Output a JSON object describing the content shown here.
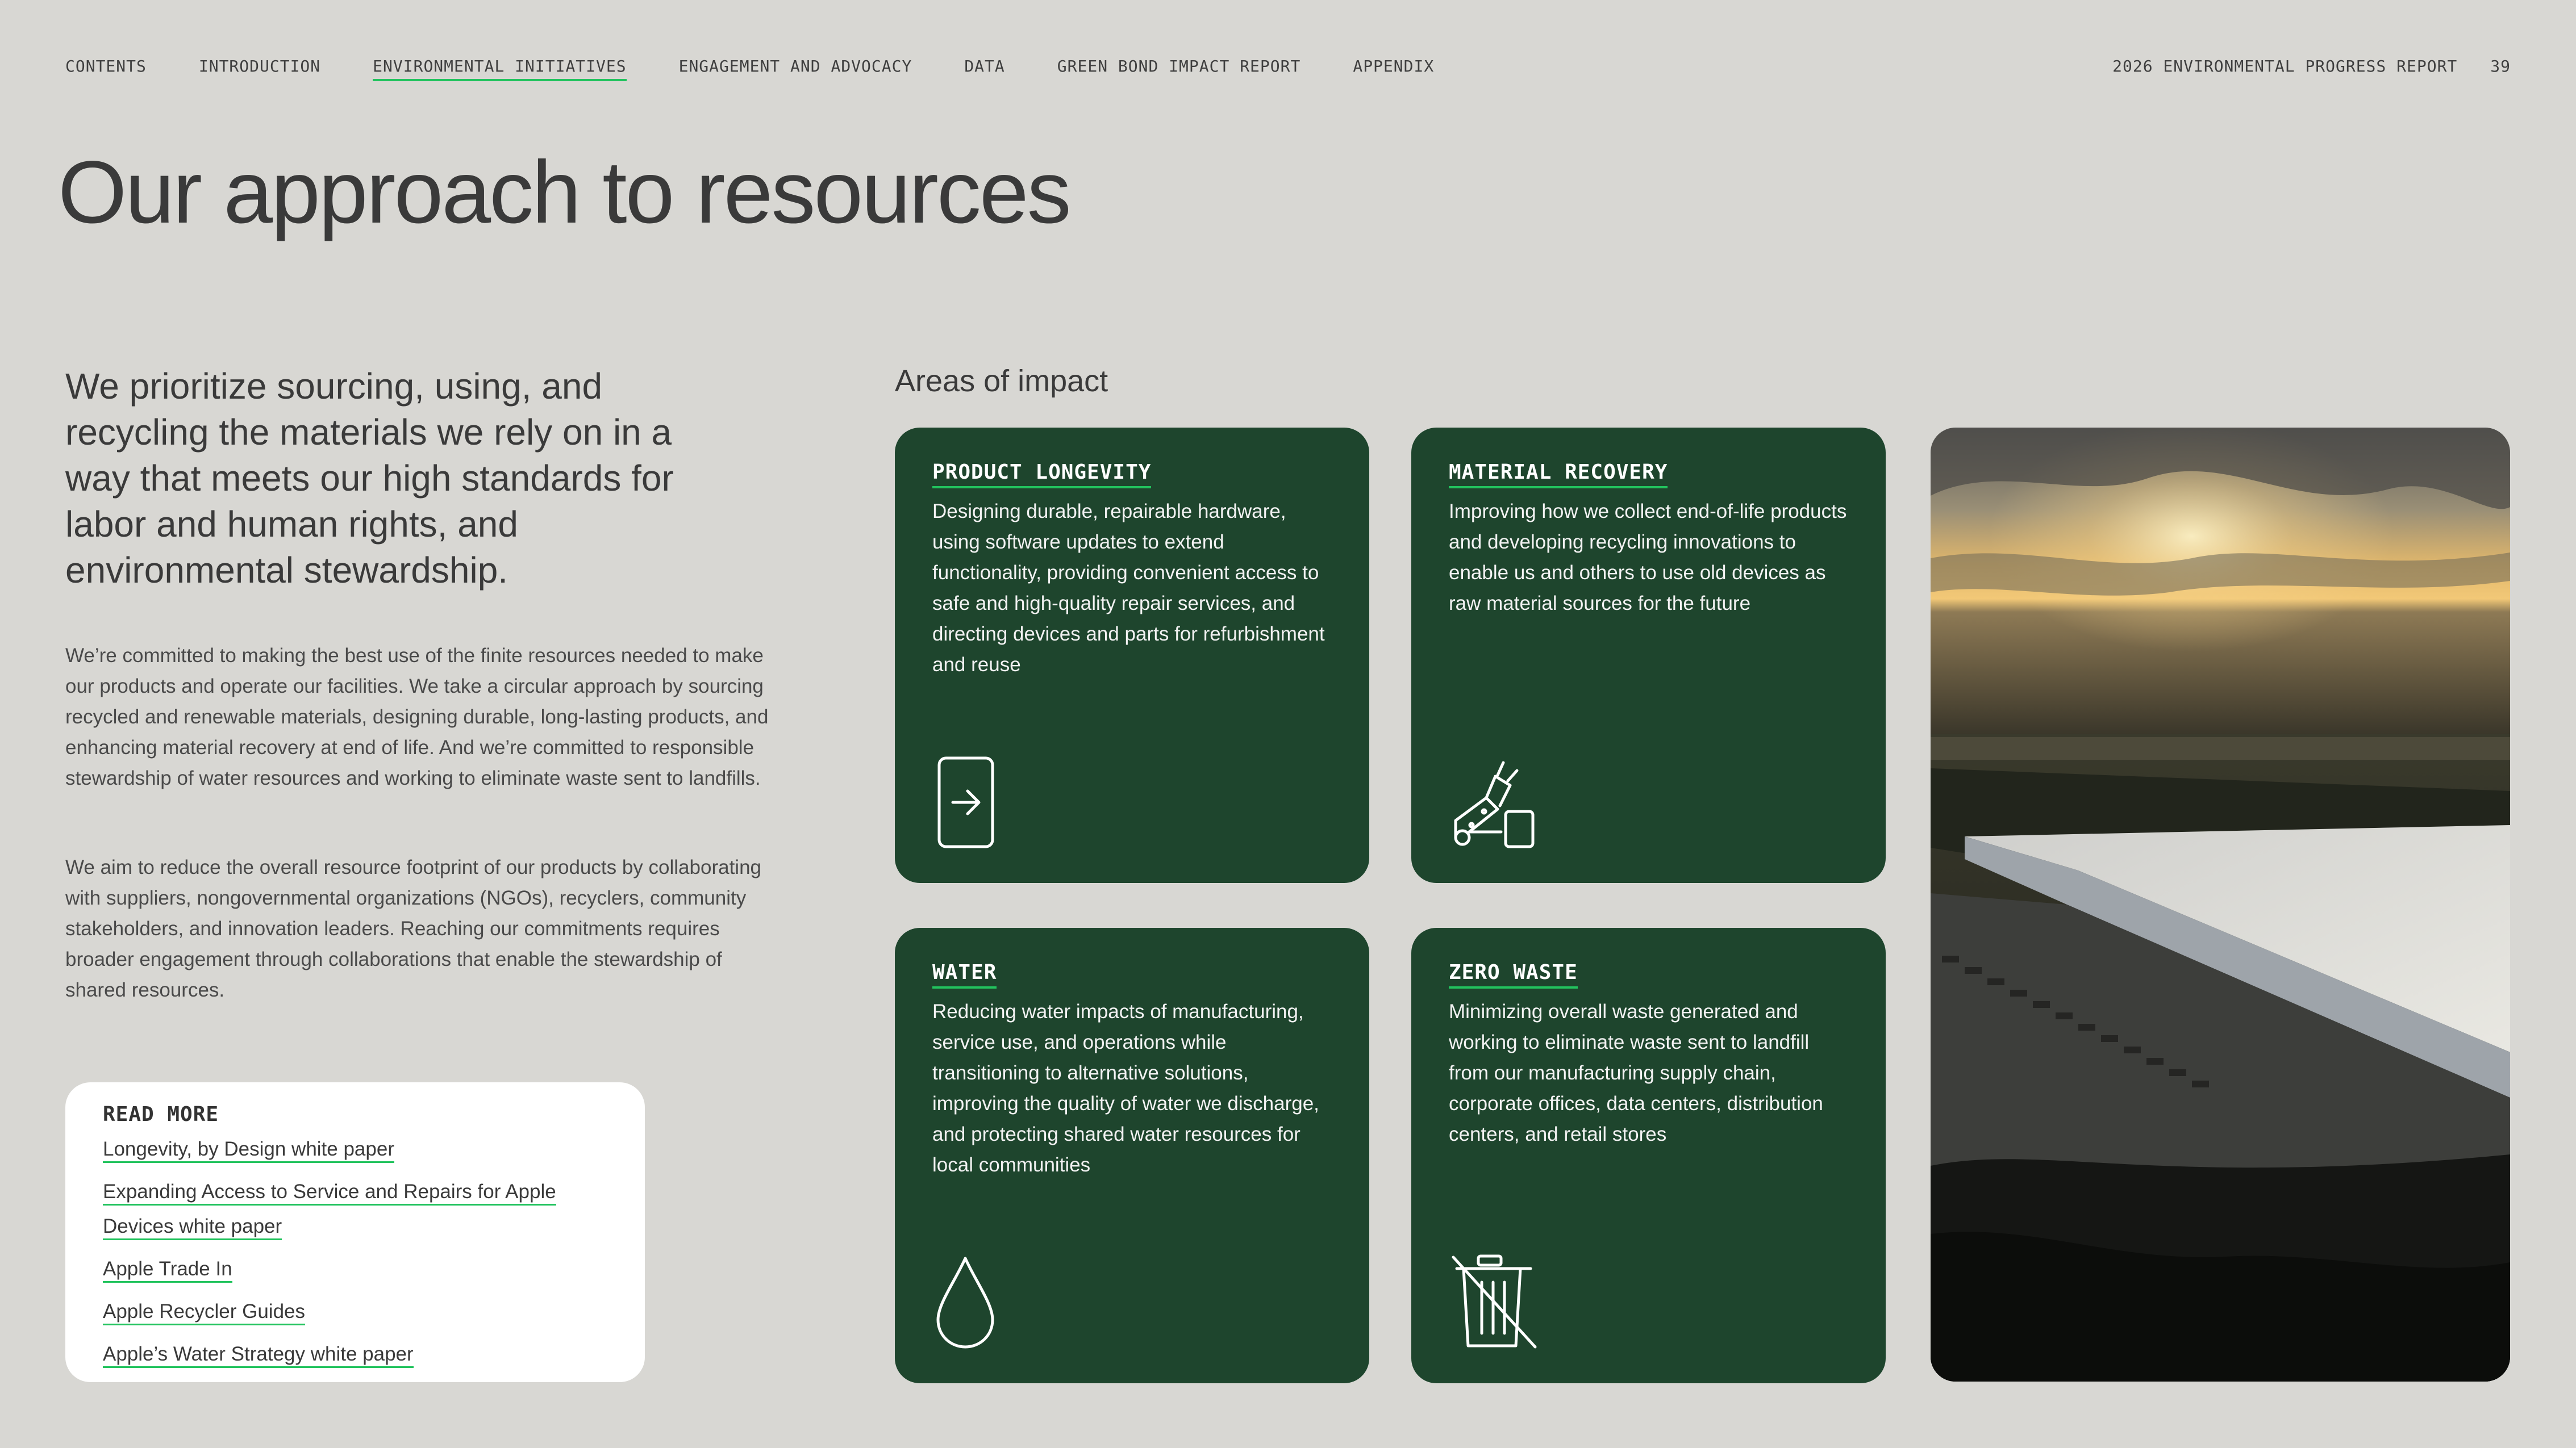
{
  "nav": {
    "items": [
      {
        "label": "CONTENTS"
      },
      {
        "label": "INTRODUCTION"
      },
      {
        "label": "ENVIRONMENTAL INITIATIVES"
      },
      {
        "label": "ENGAGEMENT AND ADVOCACY"
      },
      {
        "label": "DATA"
      },
      {
        "label": "GREEN BOND IMPACT REPORT"
      },
      {
        "label": "APPENDIX"
      }
    ],
    "active_index": 2,
    "report_title": "2026 ENVIRONMENTAL PROGRESS REPORT",
    "page_number": "39"
  },
  "page": {
    "title": "Our approach to resources",
    "lede": "We prioritize sourcing, using, and recycling the materials we rely on in a way that meets our high standards for labor and human rights, and environmental stewardship.",
    "paragraphs": [
      "We’re committed to making the best use of the finite resources needed to make our products and operate our facilities. We take a circular approach by sourcing recycled and renewable materials, designing durable, long-lasting products, and enhancing material recovery at end of life. And we’re committed to responsible stewardship of water resources and working to eliminate waste sent to landfills.",
      "We aim to reduce the overall resource footprint of our products by collaborating with suppliers, nongovernmental organizations (NGOs), recyclers, community stakeholders, and innovation leaders. Reaching our commitments requires broader engagement through collaborations that enable the stewardship of shared resources."
    ]
  },
  "read_more": {
    "heading": "READ MORE",
    "links": [
      {
        "label": "Longevity, by Design white paper"
      },
      {
        "label": "Expanding Access to Service and Repairs for Apple Devices white paper"
      },
      {
        "label": "Apple Trade In"
      },
      {
        "label": "Apple Recycler Guides"
      },
      {
        "label": "Apple’s Water Strategy white paper"
      }
    ]
  },
  "areas": {
    "title": "Areas of impact",
    "cards": [
      {
        "title": "PRODUCT LONGEVITY",
        "text": "Designing durable, repairable hardware, using software updates to extend functionality, providing convenient access to safe and high-quality repair services, and directing devices and parts for refurbishment and reuse",
        "icon": "phone-arrow-icon"
      },
      {
        "title": "MATERIAL RECOVERY",
        "text": "Improving how we collect end-of-life products and developing recycling innovations to enable us and others to use old devices as raw material sources for the future",
        "icon": "recycling-robot-icon"
      },
      {
        "title": "WATER",
        "text": "Reducing water impacts of manufacturing, service use, and operations while transitioning to alternative solutions, improving the quality of water we discharge, and protecting shared water resources for local communities",
        "icon": "water-drop-icon"
      },
      {
        "title": "ZERO WASTE",
        "text": "Minimizing overall waste generated and working to eliminate waste sent to landfill from our manufacturing supply chain, corporate offices, data centers, distribution centers, and retail stores",
        "icon": "trash-crossed-icon"
      }
    ]
  },
  "colors": {
    "background": "#d8d7d3",
    "card_green": "#1e452d",
    "accent_green": "#22c35e",
    "text_dark": "#3a3a3a"
  }
}
